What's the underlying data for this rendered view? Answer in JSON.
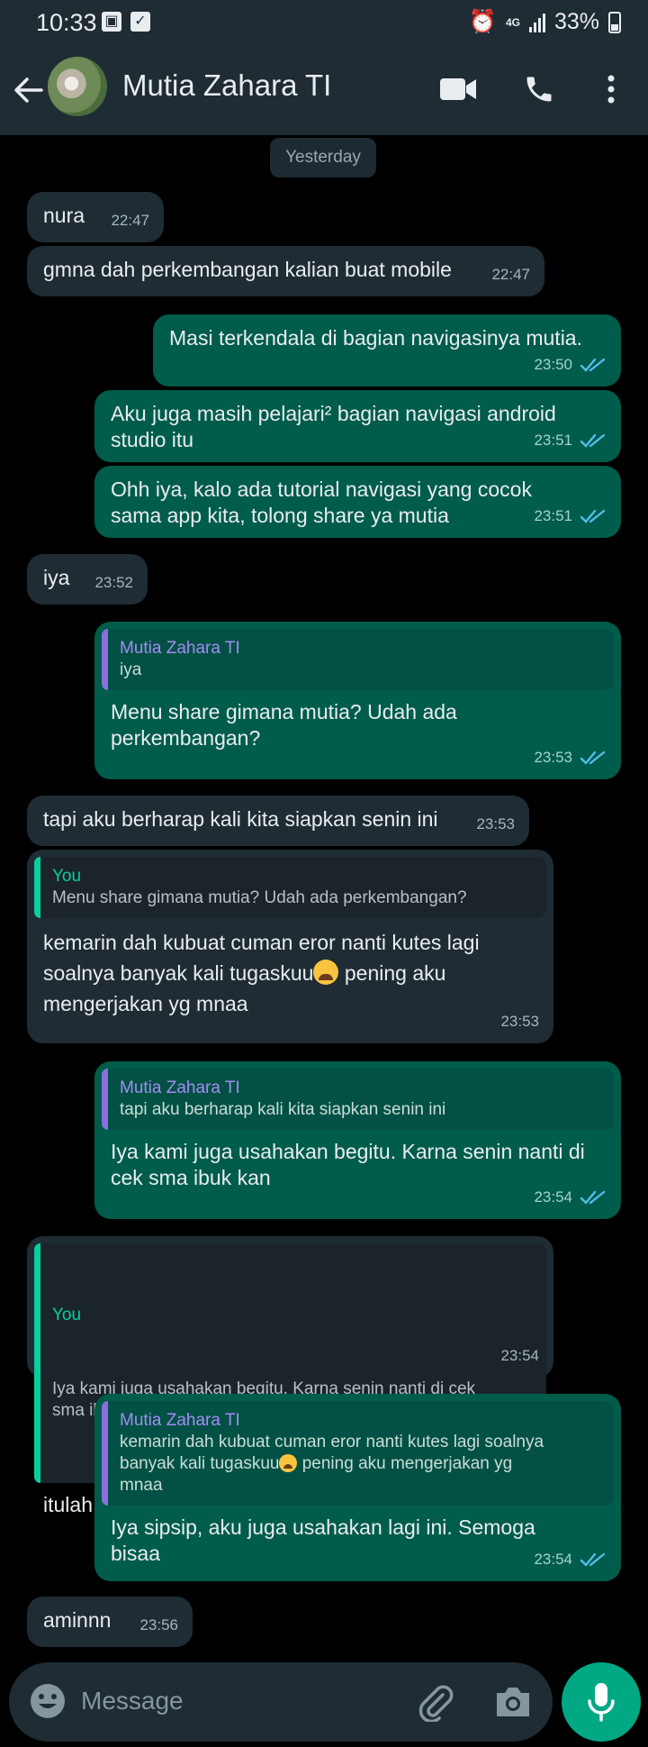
{
  "status_bar": {
    "time": "10:33",
    "network": "4G",
    "battery": "33%"
  },
  "header": {
    "contact_name": "Mutia Zahara TI"
  },
  "chat": {
    "date_label": "Yesterday",
    "messages": [
      {
        "dir": "in",
        "text": "nura",
        "time": "22:47"
      },
      {
        "dir": "in",
        "text": "gmna dah perkembangan kalian buat mobile",
        "time": "22:47"
      },
      {
        "dir": "out",
        "text": "Masi terkendala di bagian navigasinya mutia.",
        "time": "23:50"
      },
      {
        "dir": "out",
        "text": "Aku juga masih pelajari² bagian navigasi android\nstudio itu",
        "time": "23:51"
      },
      {
        "dir": "out",
        "text": "Ohh iya, kalo ada tutorial navigasi yang cocok\nsama app kita, tolong share ya mutia",
        "time": "23:51"
      },
      {
        "dir": "in",
        "text": "iya",
        "time": "23:52"
      },
      {
        "dir": "out",
        "quote_name": "Mutia Zahara TI",
        "quote_text": "iya",
        "text": "Menu share gimana mutia? Udah ada\nperkembangan?",
        "time": "23:53"
      },
      {
        "dir": "in",
        "text": "tapi aku berharap kali kita siapkan senin ini",
        "time": "23:53"
      },
      {
        "dir": "in",
        "quote_name": "You",
        "quote_text": "Menu share gimana mutia? Udah ada perkembangan?",
        "text_a": "kemarin dah kubuat cuman eror nanti kutes lagi\nsoalnya banyak kali tugaskuu",
        "text_b": " pening aku\nmengerjakan yg mnaa",
        "time": "23:53"
      },
      {
        "dir": "out",
        "quote_name": "Mutia Zahara TI",
        "quote_text": "tapi aku berharap kali kita siapkan senin ini",
        "text": "Iya kami juga usahakan begitu. Karna senin nanti di\ncek sma ibuk kan",
        "time": "23:54"
      },
      {
        "dir": "in",
        "quote_name": "You",
        "quote_text": "Iya kami juga usahakan begitu. Karna senin nanti di cek\nsma ibuk kan",
        "text": "itulah",
        "time": "23:54"
      },
      {
        "dir": "out",
        "quote_name": "Mutia Zahara TI",
        "quote_text_a": "kemarin dah kubuat cuman eror nanti kutes lagi soalnya\nbanyak kali tugaskuu",
        "quote_text_b": " pening aku mengerjakan yg\nmnaa",
        "text": "Iya sipsip, aku juga usahakan lagi ini. Semoga\nbisaa",
        "time": "23:54"
      },
      {
        "dir": "in",
        "text": "aminnn",
        "time": "23:56"
      }
    ]
  },
  "composer": {
    "placeholder": "Message"
  },
  "colors": {
    "incoming_bubble": "#1f2c34",
    "outgoing_bubble": "#005c4b",
    "accent_green": "#00a884",
    "read_ticks": "#53bdeb"
  },
  "icons": [
    "back-arrow-icon",
    "video-call-icon",
    "phone-icon",
    "more-vert-icon",
    "emoji-icon",
    "attach-icon",
    "camera-icon",
    "mic-icon"
  ]
}
